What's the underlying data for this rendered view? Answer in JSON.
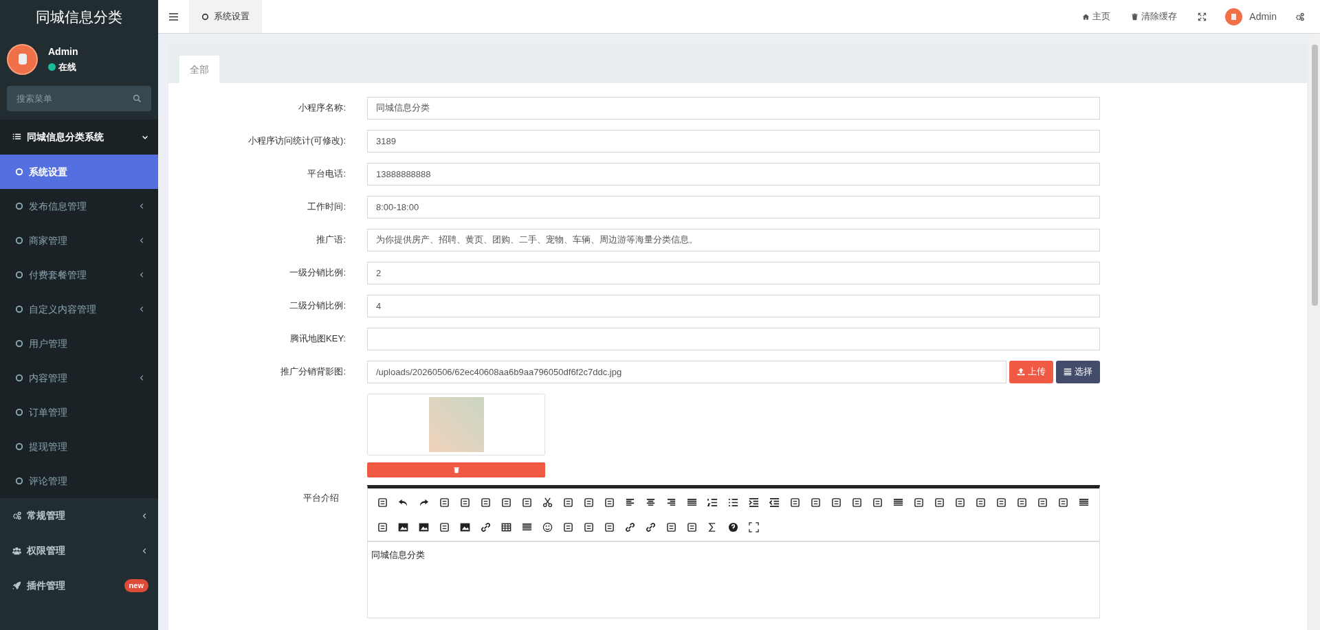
{
  "app_title": "同城信息分类",
  "user": {
    "name": "Admin",
    "status": "在线"
  },
  "sidebar": {
    "search": {
      "placeholder": "搜索菜单"
    },
    "items": [
      {
        "label": "同城信息分类系统",
        "expandable": true,
        "expanded": true,
        "children": [
          {
            "label": "系统设置",
            "selected": true,
            "expandable": false
          },
          {
            "label": "发布信息管理",
            "selected": false,
            "expandable": true
          },
          {
            "label": "商家管理",
            "selected": false,
            "expandable": true
          },
          {
            "label": "付费套餐管理",
            "selected": false,
            "expandable": true
          },
          {
            "label": "自定义内容管理",
            "selected": false,
            "expandable": true
          },
          {
            "label": "用户管理",
            "selected": false,
            "expandable": false
          },
          {
            "label": "内容管理",
            "selected": false,
            "expandable": true
          },
          {
            "label": "订单管理",
            "selected": false,
            "expandable": false
          },
          {
            "label": "提现管理",
            "selected": false,
            "expandable": false
          },
          {
            "label": "评论管理",
            "selected": false,
            "expandable": false
          }
        ]
      },
      {
        "label": "常规管理",
        "expandable": true,
        "expanded": false
      },
      {
        "label": "权限管理",
        "expandable": true,
        "expanded": false
      },
      {
        "label": "插件管理",
        "expandable": false,
        "expanded": false,
        "badge": "new"
      }
    ]
  },
  "header": {
    "tabs": [
      {
        "label": "系统设置",
        "selected": true
      }
    ],
    "links": [
      {
        "kind": "home",
        "label": "主页"
      },
      {
        "kind": "trash",
        "label": "清除缓存"
      },
      {
        "kind": "fullscreen"
      },
      {
        "kind": "user",
        "label": "Admin"
      },
      {
        "kind": "settings"
      }
    ]
  },
  "form": {
    "tabs": [
      {
        "label": "全部",
        "selected": true
      }
    ],
    "fields": [
      {
        "kind": "text",
        "label": "小程序名称:",
        "value": "同城信息分类"
      },
      {
        "kind": "text",
        "label": "小程序访问统计(可修改):",
        "value": "3189"
      },
      {
        "kind": "text",
        "label": "平台电话:",
        "value": "13888888888"
      },
      {
        "kind": "text",
        "label": "工作时间:",
        "value": "8:00-18:00"
      },
      {
        "kind": "text",
        "label": "推广语:",
        "value": "为你提供房产、招聘、黄页、团购、二手、宠物、车辆、周边游等海量分类信息。"
      },
      {
        "kind": "text",
        "label": "一级分销比例:",
        "value": "2"
      },
      {
        "kind": "text",
        "label": "二级分销比例:",
        "value": "4"
      },
      {
        "kind": "text",
        "label": "腾讯地图KEY:"
      },
      {
        "kind": "image",
        "label": "推广分销背影图:",
        "value": "/uploads/20260506/62ec40608aa6b9aa796050df6f2c7ddc.jpg",
        "buttons": [
          {
            "kind": "upload",
            "label": "上传"
          },
          {
            "kind": "choose",
            "label": "选择"
          }
        ]
      }
    ],
    "editor": {
      "label": "平台介绍",
      "content": "同城信息分类"
    }
  }
}
